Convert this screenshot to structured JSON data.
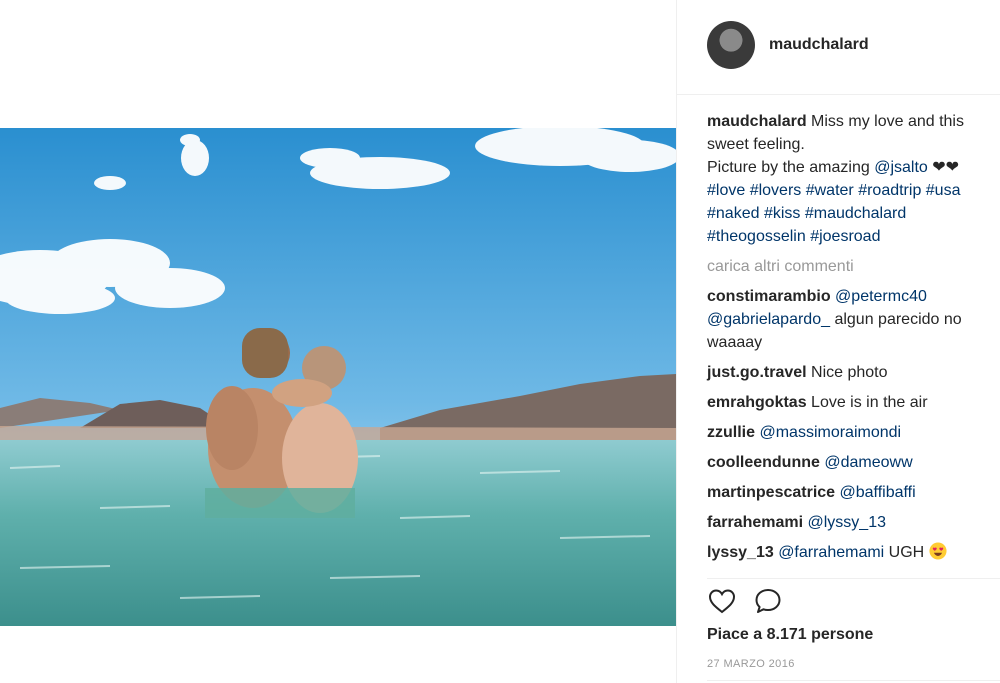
{
  "post": {
    "username": "maudchalard",
    "caption": {
      "line1_text": " Miss my love and this",
      "line2_text": "sweet feeling.",
      "line3_text": "Picture by the amazing ",
      "line3_mention": "@jsalto",
      "line3_suffix": " ❤❤",
      "hashtags_line1": "#love #lovers #water #roadtrip #usa",
      "hashtags_line2": "#naked #kiss #maudchalard",
      "hashtags_line3": "#theogosselin #joesroad"
    },
    "load_more_label": "carica altri commenti",
    "comments": [
      {
        "user": "constimarambio",
        "mention": "@petermc40",
        "mention2": "@gabrielapardo_",
        "text": " algun parecido no",
        "text2": "waaaay"
      },
      {
        "user": "just.go.travel",
        "text": " Nice photo"
      },
      {
        "user": "emrahgoktas",
        "text": " Love is in the air"
      },
      {
        "user": "zzullie",
        "mention": "@massimoraimondi"
      },
      {
        "user": "coolleendunne",
        "mention": "@dameoww"
      },
      {
        "user": "martinpescatrice",
        "mention": "@baffibaffi"
      },
      {
        "user": "farrahemami",
        "mention": "@lyssy_13"
      },
      {
        "user": "lyssy_13",
        "mention": "@farrahemami",
        "text": " UGH "
      }
    ],
    "likes_label": "Piace a 8.171 persone",
    "date_label": "27 MARZO 2016"
  },
  "icons": {
    "like": "heart-icon",
    "comment": "comment-bubble-icon",
    "emoji": "heart-eyes-emoji-icon"
  },
  "colors": {
    "link": "#003569",
    "muted": "#999999",
    "text": "#262626"
  }
}
